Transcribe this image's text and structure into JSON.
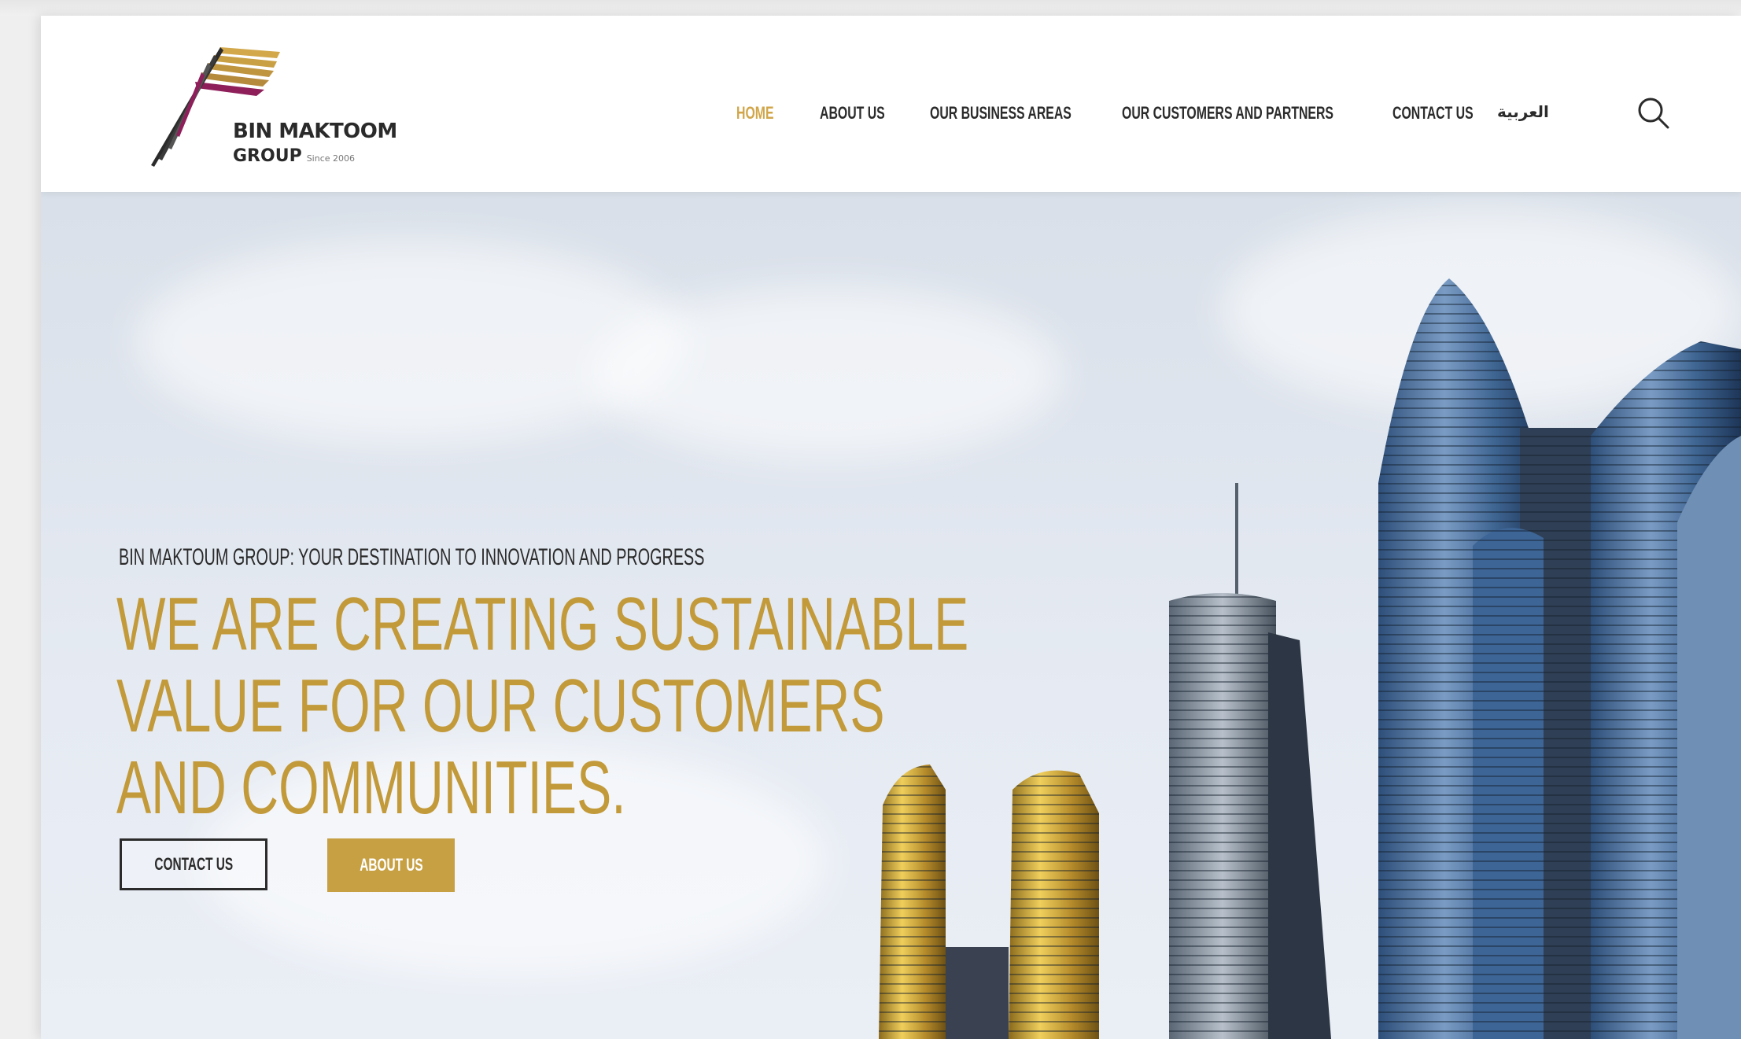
{
  "brand": {
    "name_line1": "BIN MAKTOOM",
    "name_line2": "GROUP",
    "since": "Since 2006",
    "colors": {
      "gold": "#c39a3a",
      "magenta": "#8e1f5a",
      "dark": "#2b2b2b"
    }
  },
  "nav": {
    "items": [
      {
        "label": "HOME",
        "active": true
      },
      {
        "label": "ABOUT US",
        "active": false
      },
      {
        "label": "OUR BUSINESS AREAS",
        "active": false
      },
      {
        "label": "OUR CUSTOMERS AND PARTNERS",
        "active": false
      },
      {
        "label": "CONTACT US",
        "active": false
      }
    ],
    "language": "العربية",
    "search_icon": "search-icon"
  },
  "hero": {
    "eyebrow": "BIN MAKTOUM GROUP: YOUR DESTINATION TO INNOVATION AND PROGRESS",
    "headline": [
      "WE ARE CREATING SUSTAINABLE",
      "VALUE FOR OUR CUSTOMERS",
      "AND COMMUNITIES."
    ],
    "buttons": {
      "contact": "CONTACT US",
      "about": "ABOUT US"
    }
  }
}
